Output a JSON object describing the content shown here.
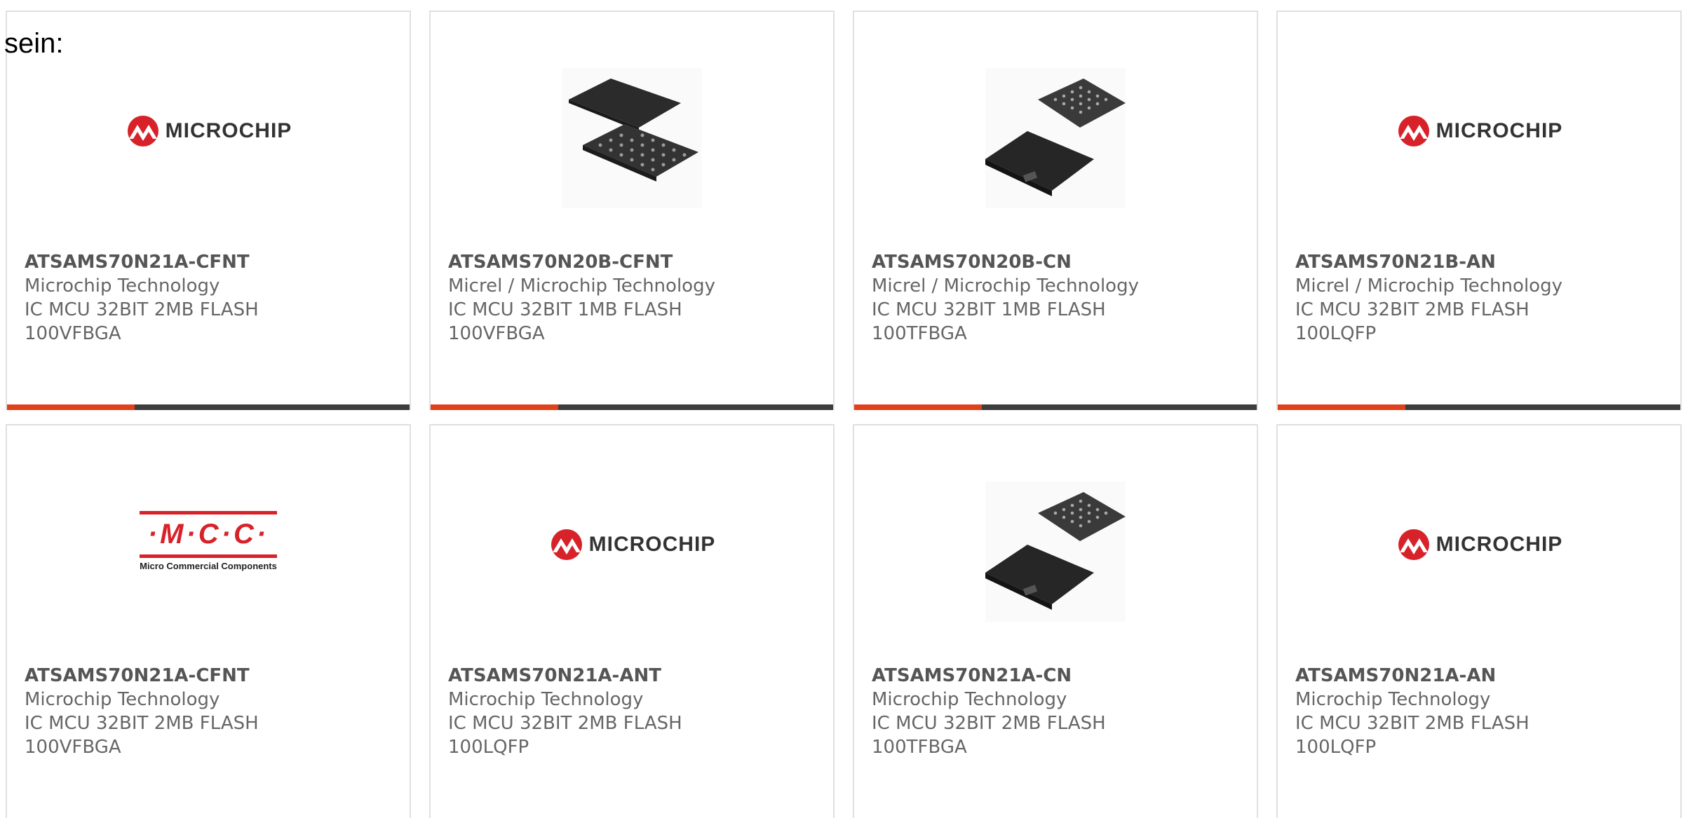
{
  "intro_text": "sein:",
  "colors": {
    "accent": "#e0401a",
    "bar": "#3d3d3d",
    "microchip_red": "#d8222a"
  },
  "logos": {
    "microchip": "MICROCHIP",
    "mcc_main": "·M·C·C·",
    "mcc_sub": "Micro Commercial Components"
  },
  "cards": [
    {
      "part": "ATSAMS70N21A-CFNT",
      "manufacturer": "Microchip Technology",
      "desc": "IC MCU 32BIT 2MB FLASH",
      "package": "100VFBGA",
      "image": "microchip-logo"
    },
    {
      "part": "ATSAMS70N20B-CFNT",
      "manufacturer": "Micrel / Microchip Technology",
      "desc": "IC MCU 32BIT 1MB FLASH",
      "package": "100VFBGA",
      "image": "bga-chip-photo"
    },
    {
      "part": "ATSAMS70N20B-CN",
      "manufacturer": "Micrel / Microchip Technology",
      "desc": "IC MCU 32BIT 1MB FLASH",
      "package": "100TFBGA",
      "image": "bga-chip-photo"
    },
    {
      "part": "ATSAMS70N21B-AN",
      "manufacturer": "Micrel / Microchip Technology",
      "desc": "IC MCU 32BIT 2MB FLASH",
      "package": "100LQFP",
      "image": "microchip-logo"
    },
    {
      "part": "ATSAMS70N21A-CFNT",
      "manufacturer": "Microchip Technology",
      "desc": "IC MCU 32BIT 2MB FLASH",
      "package": "100VFBGA",
      "image": "mcc-logo"
    },
    {
      "part": "ATSAMS70N21A-ANT",
      "manufacturer": "Microchip Technology",
      "desc": "IC MCU 32BIT 2MB FLASH",
      "package": "100LQFP",
      "image": "microchip-logo"
    },
    {
      "part": "ATSAMS70N21A-CN",
      "manufacturer": "Microchip Technology",
      "desc": "IC MCU 32BIT 2MB FLASH",
      "package": "100TFBGA",
      "image": "bga-chip-photo"
    },
    {
      "part": "ATSAMS70N21A-AN",
      "manufacturer": "Microchip Technology",
      "desc": "IC MCU 32BIT 2MB FLASH",
      "package": "100LQFP",
      "image": "microchip-logo"
    }
  ]
}
